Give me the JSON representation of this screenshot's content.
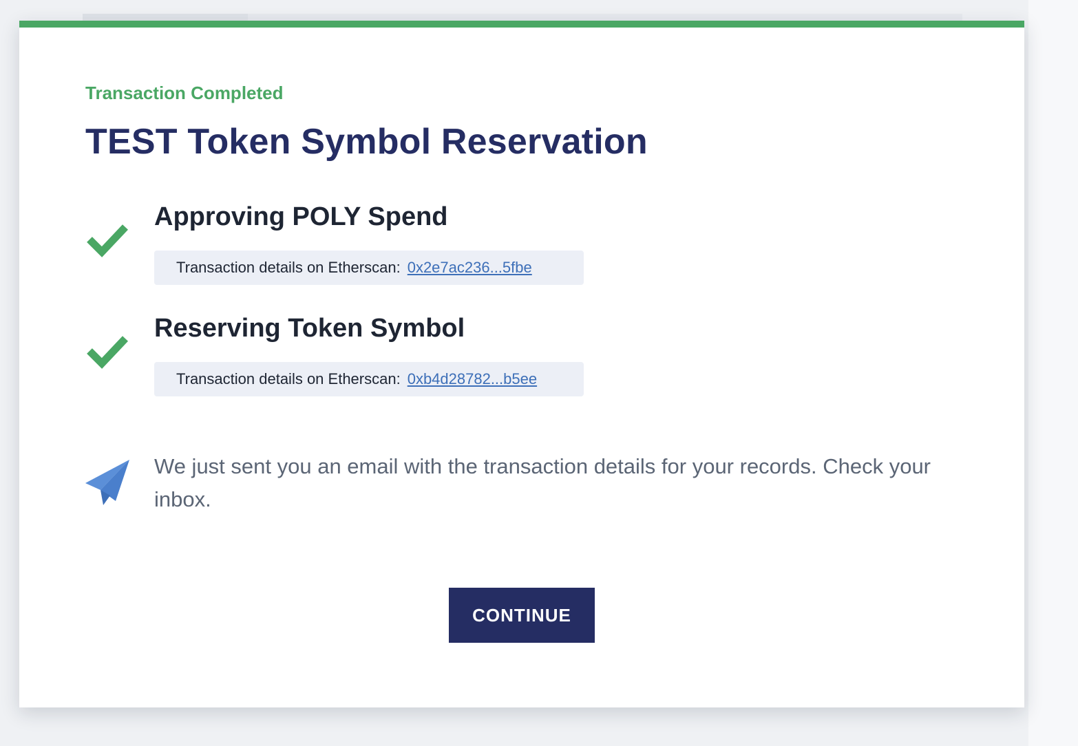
{
  "modal": {
    "status_label": "Transaction Completed",
    "title": "TEST Token Symbol Reservation",
    "steps": [
      {
        "title": "Approving POLY Spend",
        "details_label": "Transaction details on Etherscan:",
        "tx_hash": "0x2e7ac236...5fbe",
        "status_icon": "checkmark-icon"
      },
      {
        "title": "Reserving Token Symbol",
        "details_label": "Transaction details on Etherscan:",
        "tx_hash": "0xb4d28782...b5ee",
        "status_icon": "checkmark-icon"
      }
    ],
    "notice": {
      "icon": "paper-plane-icon",
      "text": "We just sent you an email with the transaction details for your records. Check your inbox."
    },
    "continue_label": "CONTINUE"
  },
  "colors": {
    "success_green": "#4aa764",
    "navy": "#252d63",
    "link_blue": "#3d6fb8",
    "details_bg": "#eceff6",
    "icon_blue": "#5b8fd8"
  }
}
